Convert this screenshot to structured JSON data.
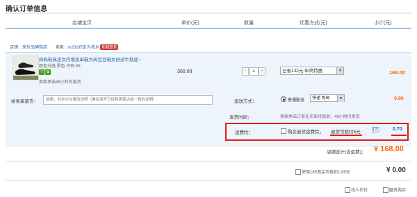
{
  "page": {
    "title": "确认订单信息"
  },
  "table_headers": {
    "item": "店铺宝贝",
    "unit_price": "单价(元)",
    "quantity": "数量",
    "discount": "优惠方式(元)",
    "subtotal": "小计(元)"
  },
  "shop": {
    "label": "店铺：",
    "name": "来乐品牌鞋店",
    "seller_label": "卖家：",
    "seller_name": "m202好定为花水",
    "contact_label": "和我联系"
  },
  "item": {
    "name": "妈妈鞋真皮女内增高单鞋大码豆豆鞋女舒适牛筋底~",
    "attrs": "颜色分类:黑色   尺码:36",
    "icon_labels": [
      "7",
      "✿"
    ],
    "ship_promise": "卖家承诺48小时内发货",
    "unit_price": "300.00",
    "qty_minus": "-",
    "qty_value": "1",
    "qty_plus": "+",
    "discount_selected": "已省132元:年终特惠",
    "subtotal": "168.00"
  },
  "message": {
    "label": "给卖家留言：",
    "placeholder": "选填：对本次交易的说明（建议填写已经和卖家达成一致的说明）"
  },
  "shipping": {
    "label": "运送方式：",
    "option": "普通配送",
    "selected": "快递  免邮",
    "amount": "0.00"
  },
  "delivery_time": {
    "label": "发货时间：",
    "value": "卖家承诺订单在买家付款后，48小时内发货"
  },
  "insurance": {
    "label": "运费险：",
    "checkbox_label": "购买退货运费险，",
    "payout": "退货可赔付6元",
    "help": "[?]",
    "amount": "0.70"
  },
  "shop_total": {
    "label": "店铺合计(含运费)：",
    "value": "¥ 168.00"
  },
  "coins": {
    "label": "使用185淘金币抵扣1.85元",
    "amount": "¥ 0.00"
  },
  "payment": {
    "option1": "找人代付",
    "option2": "匿名购买"
  },
  "colors": {
    "accent_orange": "#ff6600",
    "link_blue": "#2a5fa8",
    "highlight_red": "#e31a1a",
    "row_bg": "#eef4fb"
  },
  "icons": {
    "dropdown": "chevron-down-icon"
  }
}
